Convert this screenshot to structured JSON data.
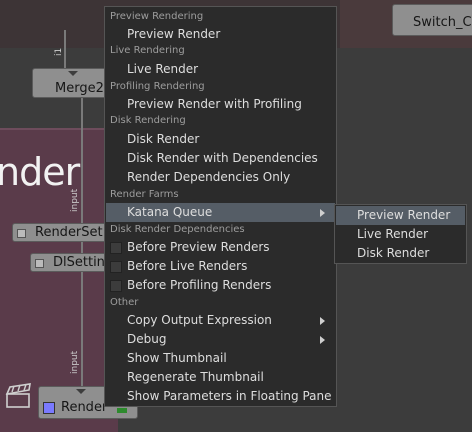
{
  "graph": {
    "backdrop_title": "nder",
    "nodes": {
      "merge": "Merge2",
      "render_settings": "RenderSet",
      "dl_settings": "DlSetting",
      "render": "Render",
      "switch": "Switch_C"
    },
    "wire_labels": {
      "top": "i1",
      "middle": "input",
      "bottom": "input"
    }
  },
  "menu": {
    "sections": {
      "preview_rendering": "Preview Rendering",
      "live_rendering": "Live Rendering",
      "profiling_rendering": "Profiling Rendering",
      "disk_rendering": "Disk Rendering",
      "render_farms": "Render Farms",
      "disk_render_dependencies": "Disk Render Dependencies",
      "other": "Other"
    },
    "items": {
      "preview_render": "Preview Render",
      "live_render": "Live Render",
      "preview_render_with_profiling": "Preview Render with Profiling",
      "disk_render": "Disk Render",
      "disk_render_with_dependencies": "Disk Render with Dependencies",
      "render_dependencies_only": "Render Dependencies Only",
      "katana_queue": "Katana Queue",
      "before_preview_renders": "Before Preview Renders",
      "before_live_renders": "Before Live Renders",
      "before_profiling_renders": "Before Profiling Renders",
      "copy_output_expression": "Copy Output Expression",
      "debug": "Debug",
      "show_thumbnail": "Show Thumbnail",
      "regenerate_thumbnail": "Regenerate Thumbnail",
      "show_parameters_in_floating_pane": "Show Parameters in Floating Pane"
    }
  },
  "submenu": {
    "items": [
      "Preview Render",
      "Live Render",
      "Disk Render"
    ],
    "highlighted_index": 0
  },
  "colors": {
    "menu_bg": "#2b2b2b",
    "highlight": "#555d66",
    "backdrop": "#5a3b4a",
    "node": "#8f8f8f"
  }
}
